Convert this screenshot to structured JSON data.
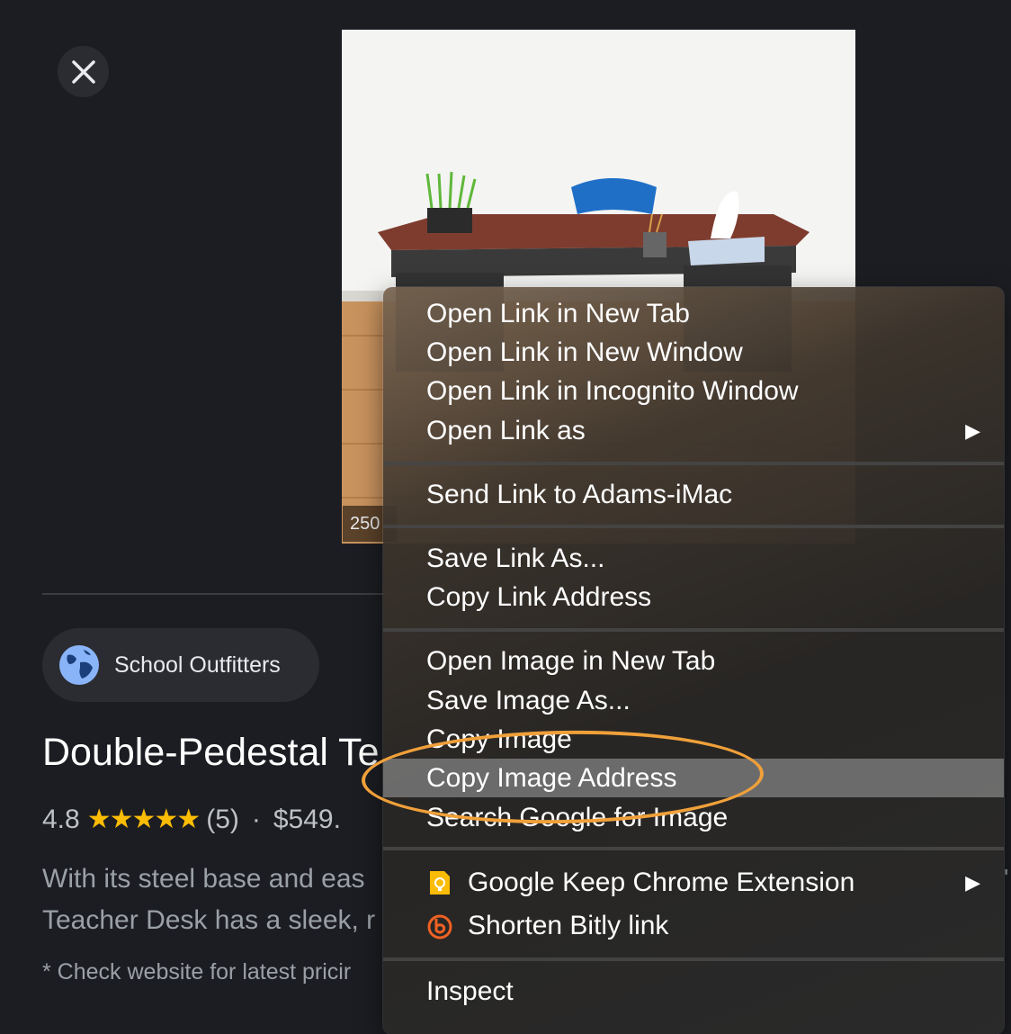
{
  "viewer": {
    "dimension_label": "250"
  },
  "source": {
    "name": "School Outfitters"
  },
  "product": {
    "title": "Double-Pedestal Te",
    "rating": "4.8",
    "stars": "★★★★★",
    "review_count": "(5)",
    "separator": "·",
    "price": "$549.",
    "description_line1": "With its steel base and eas",
    "description_line2": "Teacher Desk has a sleek, r",
    "disclaimer": "* Check website for latest pricir",
    "edge_glyph": "'"
  },
  "context_menu": {
    "groups": [
      [
        {
          "label": "Open Link in New Tab"
        },
        {
          "label": "Open Link in New Window"
        },
        {
          "label": "Open Link in Incognito Window"
        },
        {
          "label": "Open Link as",
          "submenu_arrow": "▶"
        }
      ],
      [
        {
          "label": "Send Link to Adams-iMac"
        }
      ],
      [
        {
          "label": "Save Link As..."
        },
        {
          "label": "Copy Link Address"
        }
      ],
      [
        {
          "label": "Open Image in New Tab"
        },
        {
          "label": "Save Image As..."
        },
        {
          "label": "Copy Image"
        },
        {
          "label": "Copy Image Address",
          "highlighted": true
        },
        {
          "label": "Search Google for Image"
        }
      ],
      [
        {
          "label": "Google Keep Chrome Extension",
          "submenu_arrow": "▶",
          "icon": "keep-icon"
        },
        {
          "label": "Shorten Bitly link",
          "icon": "bitly-icon"
        }
      ],
      [
        {
          "label": "Inspect"
        }
      ]
    ]
  },
  "colors": {
    "annotation_ellipse": "#f0a03a",
    "keep_yellow": "#fbbc04",
    "bitly_orange": "#ee6123",
    "star_yellow": "#fbbc04"
  }
}
